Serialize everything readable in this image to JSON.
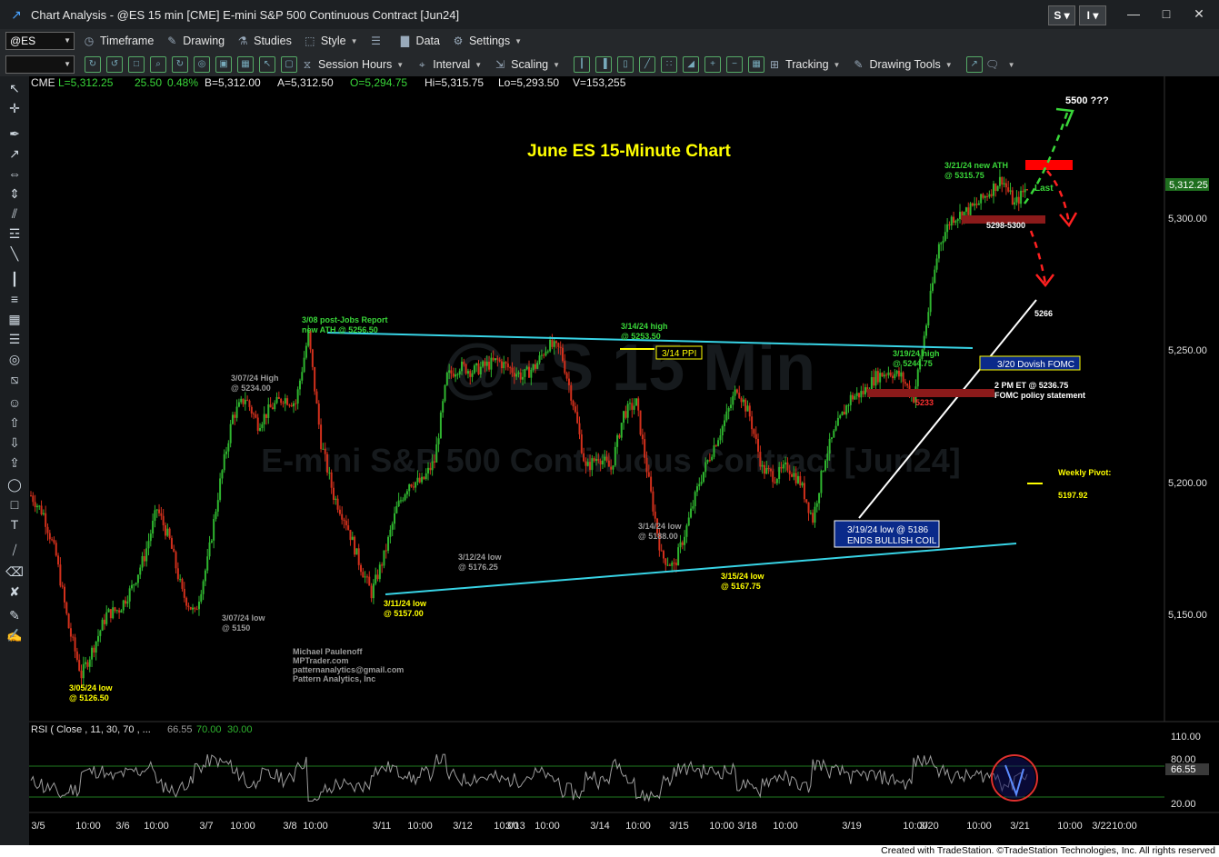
{
  "window": {
    "title": "Chart Analysis - @ES 15 min [CME] E-mini S&P 500 Continuous Contract [Jun24]",
    "btn_s": "S",
    "btn_i": "I"
  },
  "toolbar1": {
    "symbol": "@ES",
    "timeframe": "Timeframe",
    "drawing": "Drawing",
    "studies": "Studies",
    "style": "Style",
    "data": "Data",
    "settings": "Settings"
  },
  "toolbar2": {
    "session_hours": "Session Hours",
    "interval": "Interval",
    "scaling": "Scaling",
    "tracking": "Tracking",
    "drawing_tools": "Drawing Tools"
  },
  "status_line": {
    "exchange": "CME",
    "last": "L=5,312.25",
    "change": "25.50",
    "pct": "0.48%",
    "bid": "B=5,312.00",
    "ask": "A=5,312.50",
    "open": "O=5,294.75",
    "high": "Hi=5,315.75",
    "low": "Lo=5,293.50",
    "volume": "V=153,255"
  },
  "watermark": {
    "line1": "@ES 15 Min",
    "line2": "E-mini S&P 500 Continuous Contract [Jun24]"
  },
  "colors": {
    "background": "#000000",
    "up_bar": "#2fb52f",
    "down_bar": "#d2301c",
    "trendline": "#38d4e6",
    "label_yellow": "#ffff00",
    "label_green": "#39d639",
    "label_gray": "#9a9a9a",
    "resistance": "#ff0000",
    "support_zone": "#8b1a1a",
    "rsi_line": "#9c9c9c",
    "fomc_box": "#0a2a8a"
  },
  "chart_data": {
    "type": "line",
    "title": "June ES 15-Minute Chart",
    "xlabel": "",
    "ylabel": "",
    "ylim": [
      5100,
      5330
    ],
    "x_ticks": [
      "3/5",
      "10:00",
      "3/6",
      "10:00",
      "3/7",
      "10:00",
      "3/8",
      "10:00",
      "3/11",
      "10:00",
      "3/12",
      "10:00",
      "3/13",
      "10:00",
      "3/14",
      "10:00",
      "3/15",
      "10:00",
      "3/18",
      "10:00",
      "3/19",
      "10:00",
      "3/20",
      "10:00",
      "3/21",
      "10:00",
      "3/22",
      "10:00"
    ],
    "y_ticks": [
      "5,300.00",
      "5,250.00",
      "5,200.00",
      "5,150.00"
    ],
    "last_price": "5,312.25",
    "last_label": "Last",
    "series": [
      {
        "values": [
          5195,
          5188,
          5172,
          5145,
          5127,
          5138,
          5150,
          5152,
          5160,
          5172,
          5190,
          5178,
          5158,
          5150,
          5170,
          5200,
          5225,
          5232,
          5222,
          5228,
          5232,
          5230,
          5256,
          5215,
          5195,
          5185,
          5170,
          5158,
          5172,
          5190,
          5200,
          5200,
          5208,
          5240,
          5244,
          5242,
          5244,
          5246,
          5243,
          5240,
          5244,
          5252,
          5250,
          5230,
          5205,
          5210,
          5205,
          5226,
          5230,
          5200,
          5172,
          5168,
          5183,
          5200,
          5212,
          5223,
          5236,
          5225,
          5205,
          5202,
          5206,
          5200,
          5186,
          5210,
          5222,
          5232,
          5234,
          5240,
          5242,
          5240,
          5232,
          5260,
          5290,
          5300,
          5302,
          5305,
          5310,
          5315,
          5305,
          5312
        ]
      }
    ],
    "annotations": [
      {
        "text_lines": [
          "3/08 post-Jobs Report",
          "new ATH @ 5256.50"
        ],
        "color": "green"
      },
      {
        "text_lines": [
          "3/14/24 high",
          "@ 5253.50"
        ],
        "color": "green"
      },
      {
        "text_lines": [
          "3/19/24 high",
          "@ 5244.75"
        ],
        "color": "green"
      },
      {
        "text_lines": [
          "3/21/24 new ATH",
          "@ 5315.75"
        ],
        "color": "green"
      },
      {
        "text_lines": [
          "3/07/24 High",
          "@ 5234.00"
        ],
        "color": "gray"
      },
      {
        "text_lines": [
          "3/07/24 low",
          "@ 5150"
        ],
        "color": "gray"
      },
      {
        "text_lines": [
          "3/12/24 low",
          "@ 5176.25"
        ],
        "color": "gray"
      },
      {
        "text_lines": [
          "3/14/24 low",
          "@ 5188.00"
        ],
        "color": "gray"
      },
      {
        "text_lines": [
          "3/05/24 low",
          "@ 5126.50"
        ],
        "color": "yellow"
      },
      {
        "text_lines": [
          "3/11/24 low",
          "@ 5157.00"
        ],
        "color": "yellow"
      },
      {
        "text_lines": [
          "3/15/24 low",
          "@ 5167.75"
        ],
        "color": "yellow"
      },
      {
        "text_lines": [
          "3/14 PPI"
        ],
        "color": "boxed"
      },
      {
        "text_lines": [
          "3/20 Dovish FOMC"
        ],
        "color": "boxed"
      },
      {
        "text_lines": [
          "3/19/24 low @ 5186",
          "ENDS BULLISH COIL"
        ],
        "color": "blue-box"
      },
      {
        "text_lines": [
          "2 PM ET @ 5236.75",
          "FOMC policy statement"
        ],
        "color": "white"
      },
      {
        "text_lines": [
          "5233"
        ],
        "color": "red"
      },
      {
        "text_lines": [
          "5298-5300"
        ],
        "color": "white"
      },
      {
        "text_lines": [
          "5266"
        ],
        "color": "white"
      },
      {
        "text_lines": [
          "5500 ???"
        ],
        "color": "white"
      },
      {
        "text_lines": [
          "Weekly Pivot:",
          "5197.92"
        ],
        "color": "yellow"
      },
      {
        "text_lines": [
          "Michael Paulenoff",
          "MPTrader.com",
          "patternanalytics@gmail.com",
          "Pattern Analytics, Inc"
        ],
        "color": "gray"
      }
    ]
  },
  "rsi": {
    "label": "RSI ( Close , 11, 30, 70 , ...",
    "value": "66.55",
    "ob": "70.00",
    "os": "30.00",
    "y_ticks": [
      "110.00",
      "80.00",
      "66.55",
      "20.00"
    ]
  },
  "footer": {
    "text": "Created with TradeStation. ©TradeStation Technologies, Inc. All rights reserved"
  }
}
